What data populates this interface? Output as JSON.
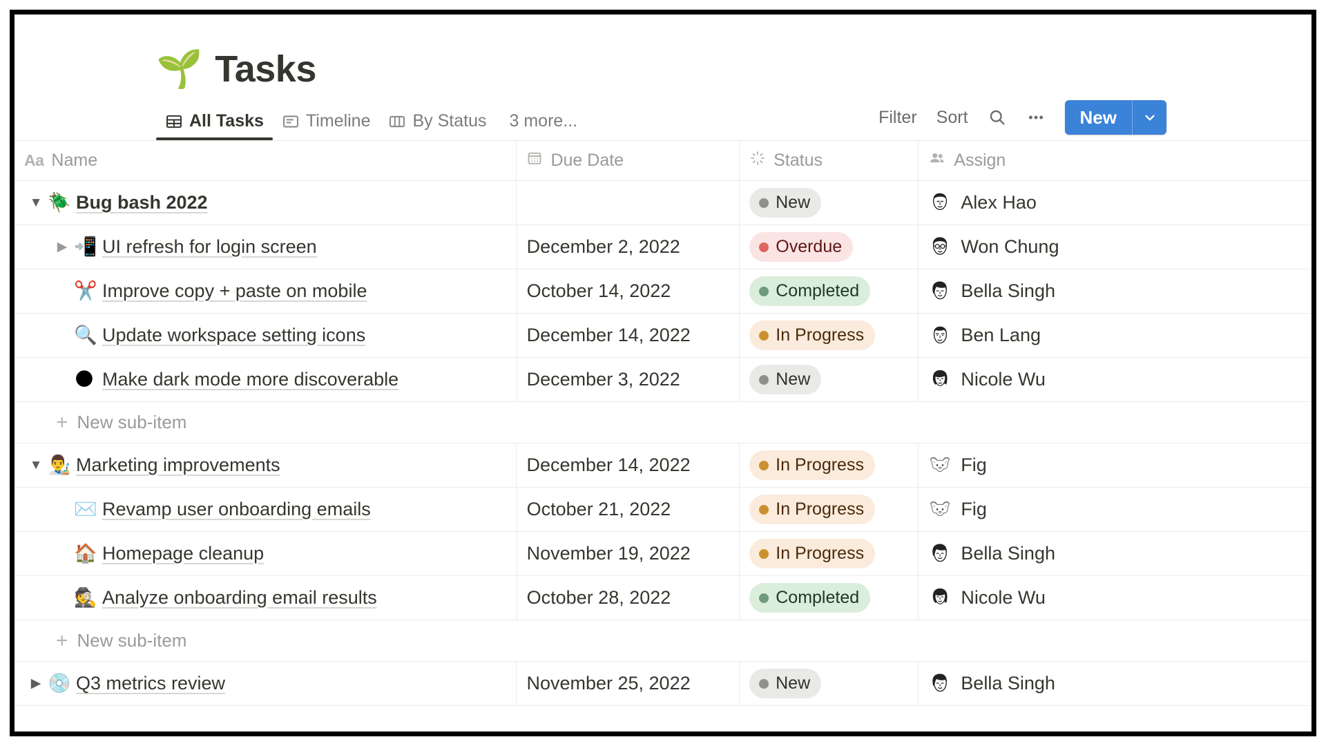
{
  "page": {
    "emoji": "🌱",
    "title": "Tasks"
  },
  "views": {
    "tabs": [
      {
        "label": "All Tasks",
        "icon": "table-icon",
        "active": true
      },
      {
        "label": "Timeline",
        "icon": "timeline-icon",
        "active": false
      },
      {
        "label": "By Status",
        "icon": "board-icon",
        "active": false
      }
    ],
    "more_label": "3 more..."
  },
  "toolbar": {
    "filter_label": "Filter",
    "sort_label": "Sort",
    "search_icon": "search-icon",
    "more_icon": "ellipsis-icon",
    "new_label": "New",
    "new_caret_icon": "chevron-down-icon",
    "new_button_color": "#3b82d9"
  },
  "table": {
    "columns": [
      {
        "key": "name",
        "label": "Name",
        "icon": "text-aa-icon"
      },
      {
        "key": "date",
        "label": "Due Date",
        "icon": "calendar-icon"
      },
      {
        "key": "status",
        "label": "Status",
        "icon": "spinner-icon"
      },
      {
        "key": "assign",
        "label": "Assign",
        "icon": "people-icon"
      }
    ],
    "rows": [
      {
        "type": "task",
        "level": 0,
        "toggle": "expanded",
        "emoji": "🪲",
        "name": "Bug bash 2022",
        "bold": true,
        "date": "",
        "status": "New",
        "status_key": "new",
        "assignee": "Alex Hao",
        "avatar": "alex"
      },
      {
        "type": "task",
        "level": 1,
        "toggle": "collapsed",
        "emoji": "📲",
        "name": "UI refresh for login screen",
        "bold": false,
        "date": "December 2, 2022",
        "status": "Overdue",
        "status_key": "overdue",
        "assignee": "Won Chung",
        "avatar": "won"
      },
      {
        "type": "task",
        "level": 1,
        "toggle": "none",
        "emoji": "✂️",
        "name": "Improve copy + paste on mobile",
        "bold": false,
        "date": "October 14, 2022",
        "status": "Completed",
        "status_key": "completed",
        "assignee": "Bella Singh",
        "avatar": "bella"
      },
      {
        "type": "task",
        "level": 1,
        "toggle": "none",
        "emoji": "🔍",
        "name": "Update workspace setting icons",
        "bold": false,
        "date": "December 14, 2022",
        "status": "In Progress",
        "status_key": "inprogress",
        "assignee": "Ben Lang",
        "avatar": "ben"
      },
      {
        "type": "task",
        "level": 1,
        "toggle": "none",
        "emoji": "🌑",
        "name": "Make dark mode more discoverable",
        "bold": false,
        "date": "December 3, 2022",
        "status": "New",
        "status_key": "new",
        "assignee": "Nicole Wu",
        "avatar": "nicole"
      },
      {
        "type": "newsub",
        "label": "New sub-item"
      },
      {
        "type": "task",
        "level": 0,
        "toggle": "expanded",
        "emoji": "👨‍🎨",
        "name": "Marketing improvements",
        "bold": false,
        "date": "December 14, 2022",
        "status": "In Progress",
        "status_key": "inprogress",
        "assignee": "Fig",
        "avatar": "fig"
      },
      {
        "type": "task",
        "level": 1,
        "toggle": "none",
        "emoji": "✉️",
        "name": "Revamp user onboarding emails",
        "bold": false,
        "date": "October 21, 2022",
        "status": "In Progress",
        "status_key": "inprogress",
        "assignee": "Fig",
        "avatar": "fig"
      },
      {
        "type": "task",
        "level": 1,
        "toggle": "none",
        "emoji": "🏠",
        "name": "Homepage cleanup",
        "bold": false,
        "date": "November 19, 2022",
        "status": "In Progress",
        "status_key": "inprogress",
        "assignee": "Bella Singh",
        "avatar": "bella"
      },
      {
        "type": "task",
        "level": 1,
        "toggle": "none",
        "emoji": "🕵️",
        "name": "Analyze onboarding email results",
        "bold": false,
        "date": "October 28, 2022",
        "status": "Completed",
        "status_key": "completed",
        "assignee": "Nicole Wu",
        "avatar": "nicole"
      },
      {
        "type": "newsub",
        "label": "New sub-item"
      },
      {
        "type": "task",
        "level": 0,
        "toggle": "collapsed",
        "emoji": "💿",
        "name": "Q3 metrics review",
        "bold": false,
        "date": "November 25, 2022",
        "status": "New",
        "status_key": "new",
        "assignee": "Bella Singh",
        "avatar": "bella"
      }
    ]
  },
  "status_colors": {
    "new": "#e9e9e7",
    "overdue": "#fbe4e4",
    "completed": "#dbeddb",
    "inprogress": "#faebdd"
  }
}
